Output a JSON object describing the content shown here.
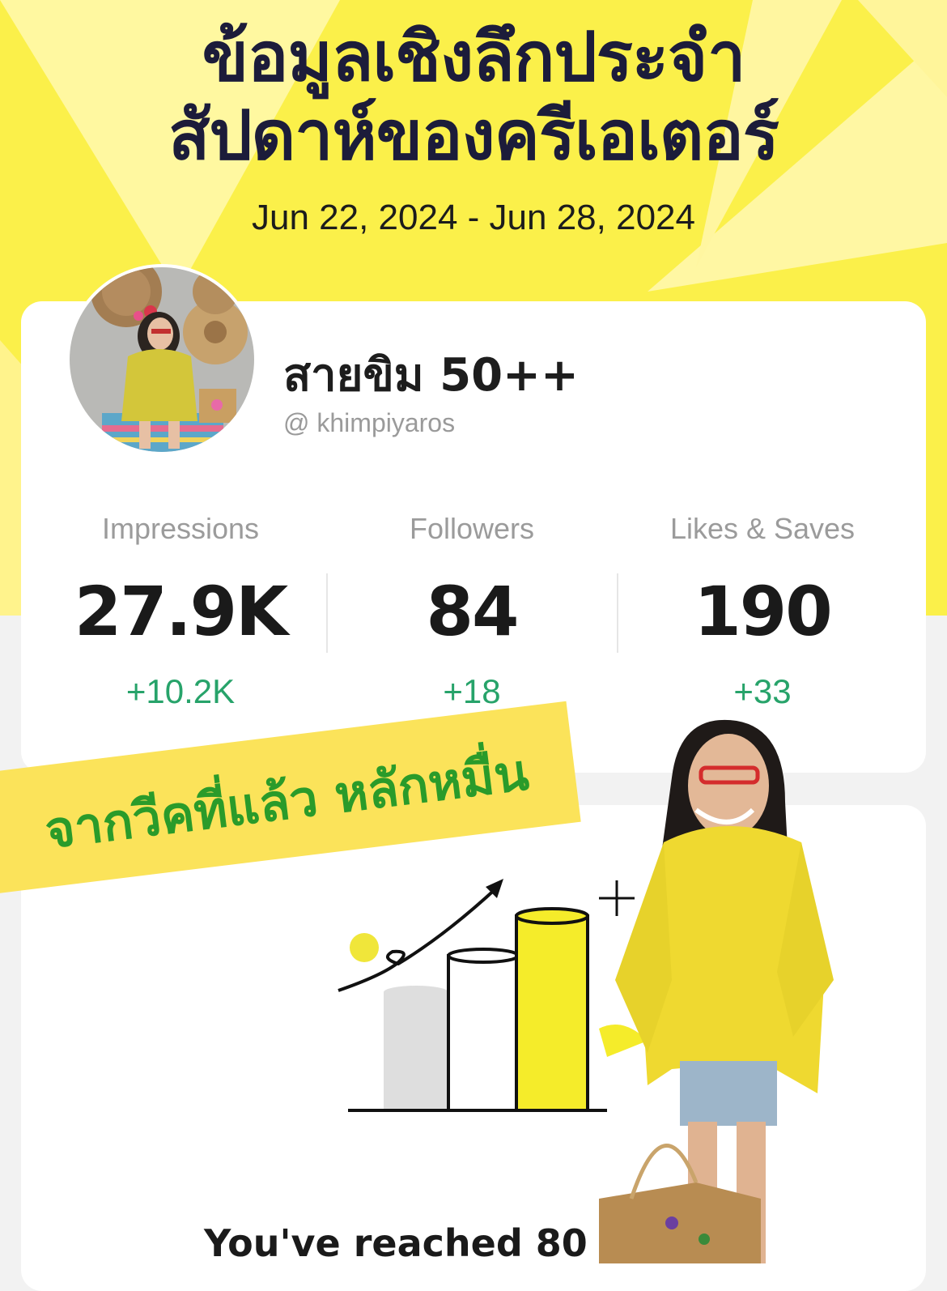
{
  "header": {
    "title_line1": "ข้อมูลเชิงลึกประจำ",
    "title_line2": "สัปดาห์ของครีเอเตอร์",
    "date_range": "Jun 22, 2024 - Jun 28, 2024"
  },
  "profile": {
    "name": "สายขิม 50++",
    "handle": "@ khimpiyaros"
  },
  "stats": [
    {
      "label": "Impressions",
      "value": "27.9K",
      "delta": "+10.2K"
    },
    {
      "label": "Followers",
      "value": "84",
      "delta": "+18"
    },
    {
      "label": "Likes & Saves",
      "value": "190",
      "delta": "+33"
    }
  ],
  "banner": {
    "text": "จากวีคที่แล้ว หลักหมื่น"
  },
  "milestone": {
    "text": "You've reached 80 fo"
  },
  "colors": {
    "hero_yellow": "#fbf04a",
    "title_navy": "#1c1c3a",
    "delta_green": "#27a36a",
    "banner_green": "#2a9b2a",
    "banner_yellow": "#fbe35a"
  }
}
